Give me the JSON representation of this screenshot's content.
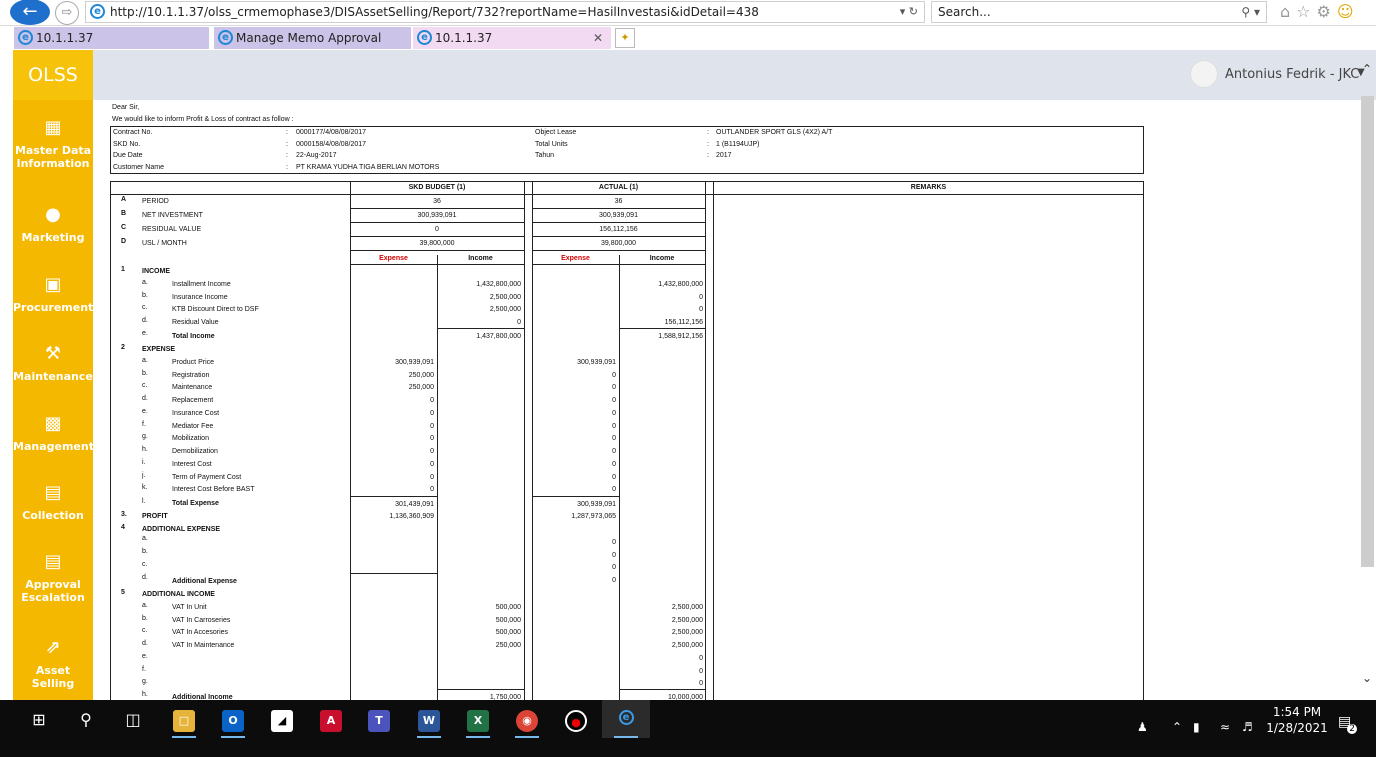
{
  "browser": {
    "url": "http://10.1.1.37/olss_crmemophase3/DISAssetSelling/Report/732?reportName=HasilInvestasi&idDetail=438",
    "search_placeholder": "Search...",
    "tabs": [
      {
        "label": "10.1.1.37"
      },
      {
        "label": "Manage Memo Approval"
      },
      {
        "label": "10.1.1.37"
      }
    ]
  },
  "app": {
    "brand": "OLSS",
    "user": "Antonius Fedrik - JKC",
    "nav": [
      {
        "label": "Master Data Information",
        "icon": "grid-icon"
      },
      {
        "label": "Marketing",
        "icon": "globe-icon"
      },
      {
        "label": "Procurement",
        "icon": "cart-icon"
      },
      {
        "label": "Maintenance",
        "icon": "wrench-icon"
      },
      {
        "label": "Management",
        "icon": "truck-icon"
      },
      {
        "label": "Collection",
        "icon": "list-icon"
      },
      {
        "label": "Approval Escalation",
        "icon": "list-icon"
      },
      {
        "label": "Asset Selling",
        "icon": "external-link-icon"
      }
    ]
  },
  "report": {
    "greeting": "Dear Sir,",
    "intro": "We would like to inform Profit & Loss of  contract as follow :",
    "contract": {
      "labels": [
        "Contract No.",
        "SKD No.",
        "Due Date",
        "Customer Name"
      ],
      "values": [
        "0000177/4/08/08/2017",
        "0000158/4/08/08/2017",
        "22-Aug-2017",
        "PT KRAMA YUDHA TIGA BERLIAN MOTORS"
      ],
      "labels2": [
        "Object Lease",
        "Total Units",
        "Tahun"
      ],
      "values2": [
        "OUTLANDER SPORT GLS (4X2) A/T",
        "1 (B1194UJP)",
        "2017"
      ]
    },
    "headers": {
      "skd": "SKD BUDGET (1)",
      "actual": "ACTUAL (1)",
      "remarks": "REMARKS",
      "expense": "Expense",
      "income": "Income"
    },
    "summary": [
      {
        "code": "A",
        "label": "PERIOD",
        "skd": "36",
        "actual": "36"
      },
      {
        "code": "B",
        "label": "NET INVESTMENT",
        "skd": "300,939,091",
        "actual": "300,939,091"
      },
      {
        "code": "C",
        "label": "RESIDUAL VALUE",
        "skd": "0",
        "actual": "156,112,156"
      },
      {
        "code": "D",
        "label": "USL / MONTH",
        "skd": "39,800,000",
        "actual": "39,800,000"
      }
    ],
    "income": {
      "code": "1",
      "title": "INCOME",
      "items": [
        {
          "letter": "a.",
          "label": "Installment Income",
          "skd": "1,432,800,000",
          "actual": "1,432,800,000"
        },
        {
          "letter": "b.",
          "label": "Insurance Income",
          "skd": "2,500,000",
          "actual": "0"
        },
        {
          "letter": "c.",
          "label": "KTB Discount Direct to DSF",
          "skd": "2,500,000",
          "actual": "0"
        },
        {
          "letter": "d.",
          "label": "Residual Value",
          "skd": "0",
          "actual": "156,112,156"
        }
      ],
      "total": {
        "letter": "e.",
        "label": "Total Income",
        "skd": "1,437,800,000",
        "actual": "1,588,912,156"
      }
    },
    "expense": {
      "code": "2",
      "title": "EXPENSE",
      "items": [
        {
          "letter": "a.",
          "label": "Product Price",
          "skd": "300,939,091",
          "actual": "300,939,091"
        },
        {
          "letter": "b.",
          "label": "Registration",
          "skd": "250,000",
          "actual": "0"
        },
        {
          "letter": "c.",
          "label": "Maintenance",
          "skd": "250,000",
          "actual": "0"
        },
        {
          "letter": "d.",
          "label": "Replacement",
          "skd": "0",
          "actual": "0"
        },
        {
          "letter": "e.",
          "label": "Insurance Cost",
          "skd": "0",
          "actual": "0"
        },
        {
          "letter": "f.",
          "label": "Mediator Fee",
          "skd": "0",
          "actual": "0"
        },
        {
          "letter": "g.",
          "label": "Mobilization",
          "skd": "0",
          "actual": "0"
        },
        {
          "letter": "h.",
          "label": "Demobilization",
          "skd": "0",
          "actual": "0"
        },
        {
          "letter": "i.",
          "label": "Interest Cost",
          "skd": "0",
          "actual": "0"
        },
        {
          "letter": "j.",
          "label": "Term of Payment Cost",
          "skd": "0",
          "actual": "0"
        },
        {
          "letter": "k.",
          "label": "Interest Cost Before BAST",
          "skd": "0",
          "actual": "0"
        }
      ],
      "total": {
        "letter": "l.",
        "label": "Total Expense",
        "skd": "301,439,091",
        "actual": "300,939,091"
      }
    },
    "profit": {
      "code": "3.",
      "label": "PROFIT",
      "skd": "1,136,360,909",
      "actual": "1,287,973,065"
    },
    "additional_expense": {
      "code": "4",
      "title": "ADDITIONAL EXPENSE",
      "items": [
        {
          "letter": "a.",
          "actual": "0"
        },
        {
          "letter": "b.",
          "actual": "0"
        },
        {
          "letter": "c.",
          "actual": "0"
        }
      ],
      "total": {
        "letter": "d.",
        "label": "Additional Expense",
        "actual": "0"
      }
    },
    "additional_income": {
      "code": "5",
      "title": "ADDITIONAL INCOME",
      "items": [
        {
          "letter": "a.",
          "label": "VAT In Unit",
          "skd": "500,000",
          "actual": "2,500,000"
        },
        {
          "letter": "b.",
          "label": "VAT In Carroseries",
          "skd": "500,000",
          "actual": "2,500,000"
        },
        {
          "letter": "c.",
          "label": "VAT In Accesories",
          "skd": "500,000",
          "actual": "2,500,000"
        },
        {
          "letter": "d.",
          "label": "VAT In Maintenance",
          "skd": "250,000",
          "actual": "2,500,000"
        },
        {
          "letter": "e.",
          "label": "",
          "skd": "",
          "actual": "0"
        },
        {
          "letter": "f.",
          "label": "",
          "skd": "",
          "actual": "0"
        },
        {
          "letter": "g.",
          "label": "",
          "skd": "",
          "actual": "0"
        }
      ],
      "total": {
        "letter": "h.",
        "label": "Additional Income",
        "skd": "1,750,000",
        "actual": "10,000,000"
      }
    }
  },
  "taskbar": {
    "time": "1:54 PM",
    "date": "1/28/2021",
    "notifications": "2"
  }
}
